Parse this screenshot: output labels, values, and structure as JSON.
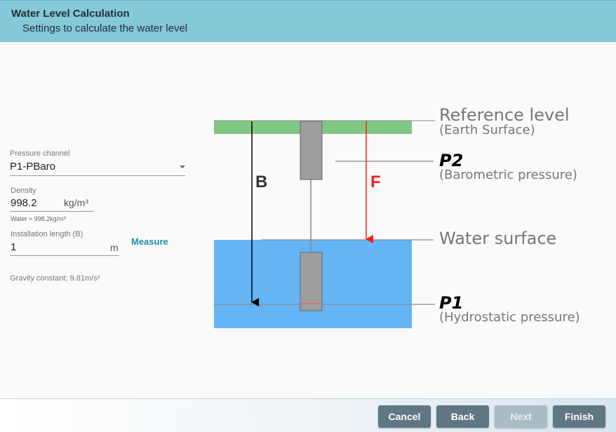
{
  "header": {
    "title": "Water Level Calculation",
    "subtitle": "Settings to calculate the water level"
  },
  "form": {
    "pressure_channel": {
      "label": "Pressure channel",
      "value": "P1-PBaro"
    },
    "density": {
      "label": "Density",
      "value": "998.2",
      "unit": "kg/m³",
      "hint": "Water ≈ 998.2kg/m³"
    },
    "installation_length": {
      "label": "Installation length (B)",
      "value": "1",
      "unit": "m"
    },
    "measure_label": "Measure",
    "gravity": "Gravity constant: 9.81m/s²"
  },
  "diagram": {
    "reference_level": "Reference level",
    "earth_surface": "(Earth Surface)",
    "p2": "P2",
    "barometric": "(Barometric pressure)",
    "water_surface": "Water surface",
    "p1": "P1",
    "hydrostatic": "(Hydrostatic pressure)",
    "b_label": "B",
    "f_label": "F",
    "colors": {
      "ground": "#81c784",
      "water": "#64b5f6",
      "sensor": "#9e9e9e",
      "arrow_f": "#ff1a1a",
      "arrow_b": "#000000"
    }
  },
  "footer": {
    "cancel": "Cancel",
    "back": "Back",
    "next": "Next",
    "finish": "Finish"
  }
}
